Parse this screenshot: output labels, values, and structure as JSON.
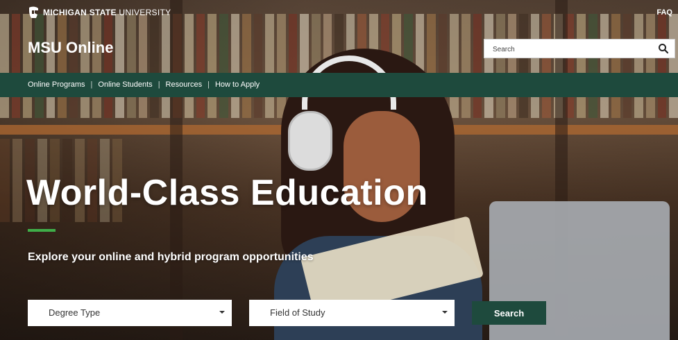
{
  "header": {
    "university_bold": "MICHIGAN STATE",
    "university_light": "UNIVERSITY",
    "faq": "FAQ",
    "site_title": "MSU Online",
    "search": {
      "placeholder": "Search"
    }
  },
  "nav": {
    "items": [
      {
        "label": "Online Programs"
      },
      {
        "label": "Online Students"
      },
      {
        "label": "Resources"
      },
      {
        "label": "How to Apply"
      }
    ],
    "separator": "|"
  },
  "hero": {
    "headline": "World-Class Education",
    "subhead": "Explore your online and hybrid program opportunities"
  },
  "filters": {
    "degree_type": "Degree Type",
    "field_of_study": "Field of Study",
    "search_button": "Search"
  },
  "colors": {
    "brand_green": "#1e4a3d",
    "accent_green": "#3fae49"
  },
  "icons": {
    "logo": "spartan-helmet-icon",
    "search": "search-icon",
    "dropdown": "caret-down-icon"
  }
}
